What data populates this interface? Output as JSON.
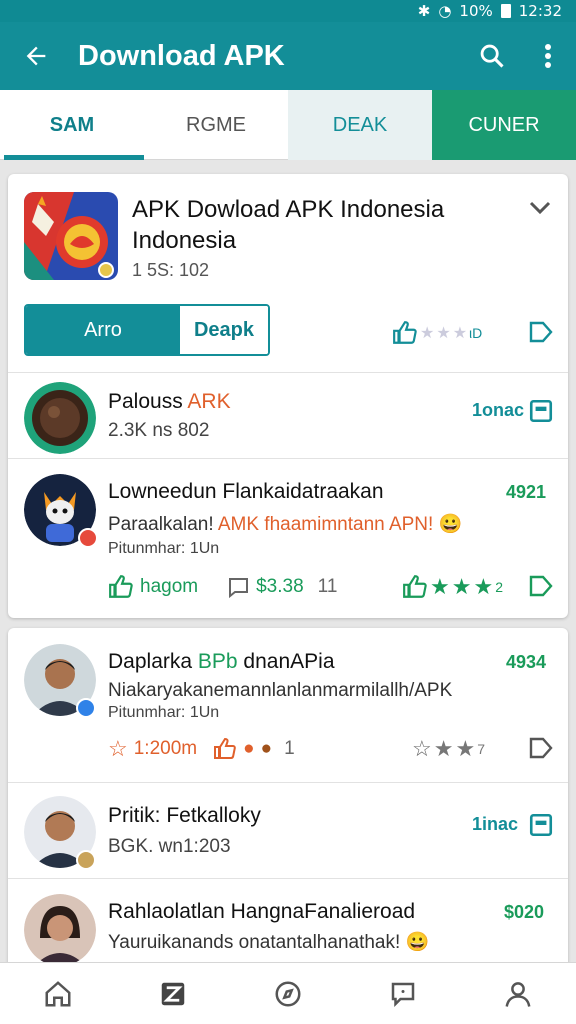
{
  "status": {
    "time": "12:32",
    "battery": "10%"
  },
  "appbar": {
    "title": "Download APK"
  },
  "tabs": [
    {
      "label": "SAM"
    },
    {
      "label": "RGME"
    },
    {
      "label": "DEAK"
    },
    {
      "label": "CUNER"
    }
  ],
  "featured": {
    "title": "APK Dowload APK Indonesia Indonesia",
    "meta": "1 5S: 102",
    "primary_button": "Arro",
    "secondary_button": "Deapk",
    "reaction": "ιD"
  },
  "items": [
    {
      "name": "Palouss",
      "name_accent": "ARK",
      "meta": "2.3K ns 802",
      "action": "1onac"
    },
    {
      "name": "Lowneedun Flankaidatraakan",
      "line1_plain": "Paraalkalan! ",
      "line1_accent": "AMK fhaamimntann APN!",
      "line1_emoji": "😀",
      "line2": "Pitunmhar: 1Un",
      "count": "4921",
      "like_label": "hagom",
      "comment_count": "$3.38",
      "comment_extra": "11",
      "reaction": "2"
    },
    {
      "name": "Daplarka ",
      "name_accent": "BPb",
      "name_tail": " dnanAPia",
      "line1": "Niakaryakanemannlanlanmarmilallh/APK",
      "line2": "Pitunmhar: 1Un",
      "count": "4934",
      "star_count": "1:200m",
      "reaction_count": "1",
      "reaction_right": "7"
    },
    {
      "name": "Pritik: Fetkalloky",
      "meta": "BGK. wn1:203",
      "action": "1inac"
    },
    {
      "name": "Rahlaolatlan HangnaFanalieroad",
      "line1": "Yauruikanands onatantalhanathak!",
      "line1_emoji": "😀",
      "count": "$020"
    }
  ]
}
